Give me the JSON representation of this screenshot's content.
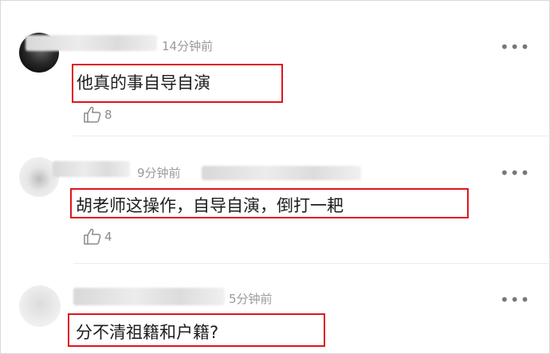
{
  "comments": [
    {
      "time": "14分钟前",
      "text": "他真的事自导自演",
      "likes": "8"
    },
    {
      "time": "9分钟前",
      "text": "胡老师这操作，自导自演，倒打一耙",
      "likes": "4"
    },
    {
      "time": "5分钟前",
      "text": "分不清祖籍和户籍?",
      "likes": ""
    }
  ],
  "icons": {
    "more": "more-icon",
    "like": "thumbs-up-icon"
  }
}
